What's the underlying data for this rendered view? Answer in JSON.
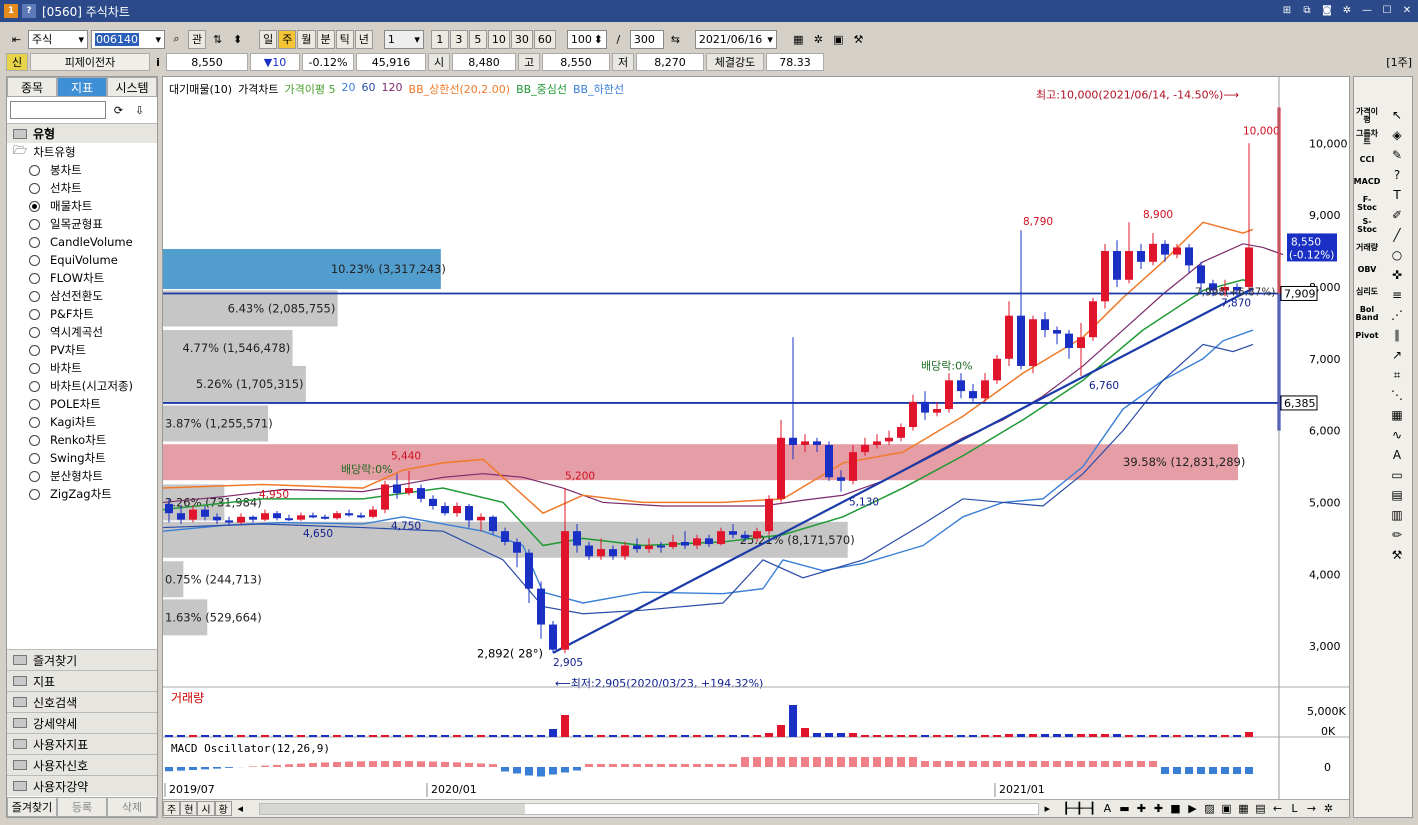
{
  "title": "[0560] 주식차트",
  "toolbar": {
    "market": "주식",
    "code": "006140",
    "btn_gwan": "관",
    "periods": [
      "일",
      "주",
      "월",
      "분",
      "틱",
      "년"
    ],
    "selected_period": "주",
    "count_select": "1",
    "nums": [
      "1",
      "3",
      "5",
      "10",
      "30",
      "60"
    ],
    "zoom": "100",
    "slash": "/",
    "total": "300",
    "date": "2021/06/16"
  },
  "quote": {
    "badge": "신",
    "name": "피제이전자",
    "price": "8,550",
    "change": "▼10",
    "rate": "-0.12%",
    "volume": "45,916",
    "open_label": "시",
    "open": "8,480",
    "high_label": "고",
    "high": "8,550",
    "low_label": "저",
    "low": "8,270",
    "strength_label": "체결강도",
    "strength": "78.33",
    "unit": "[1주]"
  },
  "left": {
    "tabs": [
      "종목",
      "지표",
      "시스템"
    ],
    "selected_tab": "지표",
    "section": "유형",
    "tree_root": "차트유형",
    "chart_types": [
      "봉차트",
      "선차트",
      "매물차트",
      "일목균형표",
      "CandleVolume",
      "EquiVolume",
      "FLOW차트",
      "삼선전환도",
      "P&F차트",
      "역시계곡선",
      "PV차트",
      "바차트",
      "바차트(시고저종)",
      "POLE차트",
      "Kagi차트",
      "Renko차트",
      "Swing차트",
      "분산형차트",
      "ZigZag차트"
    ],
    "selected_type": "매물차트",
    "folders": [
      "즐겨찾기",
      "지표",
      "신호검색",
      "강세약세",
      "사용자지표",
      "사용자신호",
      "사용자강약"
    ],
    "bottom": [
      "즐겨찾기",
      "등록",
      "삭제"
    ]
  },
  "legend": {
    "volume_profile": "대기매물(10)",
    "price": "가격차트",
    "ma_label": "가격이평 5",
    "ma20": "20",
    "ma60": "60",
    "ma120": "120",
    "bb_up": "BB_상한선(20,2.00)",
    "bb_mid": "BB_중심선",
    "bb_low": "BB_하한선"
  },
  "annotations": {
    "max": "최고:10,000(2021/06/14, -14.50%)⟶",
    "min": "⟵최저:2,905(2020/03/23, +194.32%)",
    "div1": "배당락:0%",
    "div2": "배당락:0%",
    "trend": "2,892( 28°)",
    "l10000": "10,000",
    "l8790": "8,790",
    "l8900": "8,900",
    "l7870": "7,870",
    "l6760": "6,760",
    "l5130": "5,130",
    "l5200": "5,200",
    "l5440": "5,440",
    "l4950": "4,950",
    "l4750": "4,750",
    "l4650": "4,650",
    "l2905": "2,905",
    "l7998": "7,998(+6.87%)"
  },
  "profile": [
    {
      "label": "10.23% (3,317,243)",
      "pct": 10.23,
      "price": 8250,
      "color": "#3f94c9"
    },
    {
      "label": "6.43% (2,085,755)",
      "pct": 6.43,
      "price": 7700,
      "color": "#c0c0c0"
    },
    {
      "label": "4.77% (1,546,478)",
      "pct": 4.77,
      "price": 7150,
      "color": "#c0c0c0"
    },
    {
      "label": "5.26% (1,705,315)",
      "pct": 5.26,
      "price": 6650,
      "color": "#c0c0c0"
    },
    {
      "label": "3.87% (1,255,571)",
      "pct": 3.87,
      "price": 6100,
      "color": "#c0c0c0"
    },
    {
      "label": "39.58% (12,831,289)",
      "pct": 39.58,
      "price": 5560,
      "color": "#e3949c"
    },
    {
      "label": "2.26% (731,984)",
      "pct": 2.26,
      "price": 5000,
      "color": "#c0c0c0"
    },
    {
      "label": "25.21% (8,171,570)",
      "pct": 25.21,
      "price": 4480,
      "color": "#c0c0c0"
    },
    {
      "label": "0.75% (244,713)",
      "pct": 0.75,
      "price": 3930,
      "color": "#c0c0c0"
    },
    {
      "label": "1.63% (529,664)",
      "pct": 1.63,
      "price": 3400,
      "color": "#c0c0c0"
    }
  ],
  "price_axis": {
    "ticks": [
      "10,000",
      "9,000",
      "8,000",
      "7,000",
      "6,000",
      "5,000",
      "4,000",
      "3,000"
    ],
    "min": 2500,
    "max": 10700
  },
  "hlines": [
    {
      "price": 7909,
      "label": "7,909"
    },
    {
      "price": 6385,
      "label": "6,385"
    }
  ],
  "current": {
    "price": "8,550",
    "rate": "(-0.12%)"
  },
  "panels": {
    "volume": "거래량",
    "volume_ticks": [
      "5,000K",
      "0K"
    ],
    "macd": "MACD Oscillator(12,26,9)",
    "macd_tick": "0"
  },
  "dates": [
    "2019/07",
    "2020/01",
    "2021/01"
  ],
  "bottombar": [
    "주",
    "현",
    "시",
    "황"
  ],
  "right": [
    "가격이평",
    "그룹차트",
    "CCI",
    "MACD",
    "F-Stoc",
    "S-Stoc",
    "거래량",
    "OBV",
    "심리도",
    "Bol Band",
    "Pivot"
  ],
  "colors": {
    "up": "#e0142a",
    "down": "#1a2fc4",
    "bb_up": "#f07a2a",
    "bb_mid": "#1f9a34",
    "ma": "#3a7fd6",
    "ma60": "#2a4ca8",
    "ma120": "#7a2a6a",
    "trend": "#1a3aa8"
  }
}
